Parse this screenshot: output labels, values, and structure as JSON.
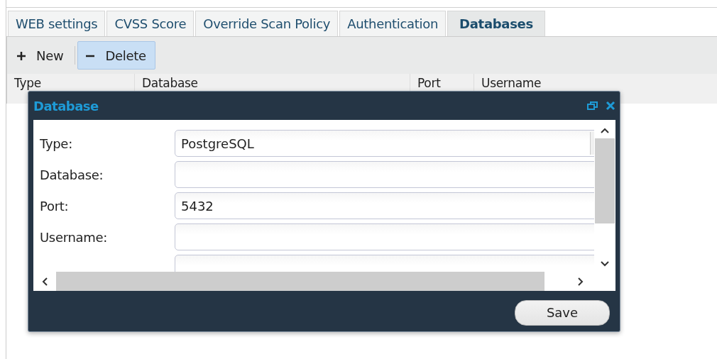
{
  "tabs": [
    {
      "label": "WEB settings",
      "selected": false
    },
    {
      "label": "CVSS Score",
      "selected": false
    },
    {
      "label": "Override Scan Policy",
      "selected": false
    },
    {
      "label": "Authentication",
      "selected": false
    },
    {
      "label": "Databases",
      "selected": true
    }
  ],
  "toolbar": [
    {
      "kind": "add",
      "label": "New",
      "highlighted": false
    },
    {
      "kind": "remove",
      "label": "Delete",
      "highlighted": true
    }
  ],
  "table": {
    "columns": [
      "Type",
      "Database",
      "Port",
      "Username"
    ]
  },
  "dialog": {
    "title": "Database",
    "fields": [
      {
        "kind": "select",
        "label": "Type:",
        "value": "PostgreSQL"
      },
      {
        "kind": "text",
        "label": "Database:"
      },
      {
        "kind": "text",
        "label": "Port:",
        "value": "5432"
      },
      {
        "kind": "text",
        "label": "Username:"
      },
      {
        "kind": "text"
      }
    ],
    "buttons": [
      "Save"
    ]
  }
}
